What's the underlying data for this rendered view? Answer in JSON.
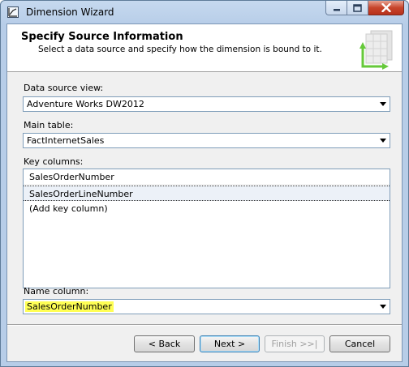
{
  "window": {
    "title": "Dimension Wizard"
  },
  "header": {
    "title": "Specify Source Information",
    "subtitle": "Select a data source and specify how the dimension is bound to it."
  },
  "data_source_view": {
    "label": "Data source view:",
    "value": "Adventure Works DW2012"
  },
  "main_table": {
    "label": "Main table:",
    "value": "FactInternetSales"
  },
  "key_columns": {
    "label": "Key columns:",
    "rows": [
      "SalesOrderNumber",
      "SalesOrderLineNumber",
      "(Add key column)"
    ],
    "selected_index": 1
  },
  "name_column": {
    "label": "Name column:",
    "value": "SalesOrderNumber",
    "highlight_color": "#ffff55"
  },
  "buttons": {
    "back": "< Back",
    "next": "Next >",
    "finish": "Finish >>|",
    "cancel": "Cancel"
  },
  "icons": {
    "app": "wizard-icon",
    "header": "dimension-cube-icon",
    "dropdown": "chevron-down-icon"
  }
}
